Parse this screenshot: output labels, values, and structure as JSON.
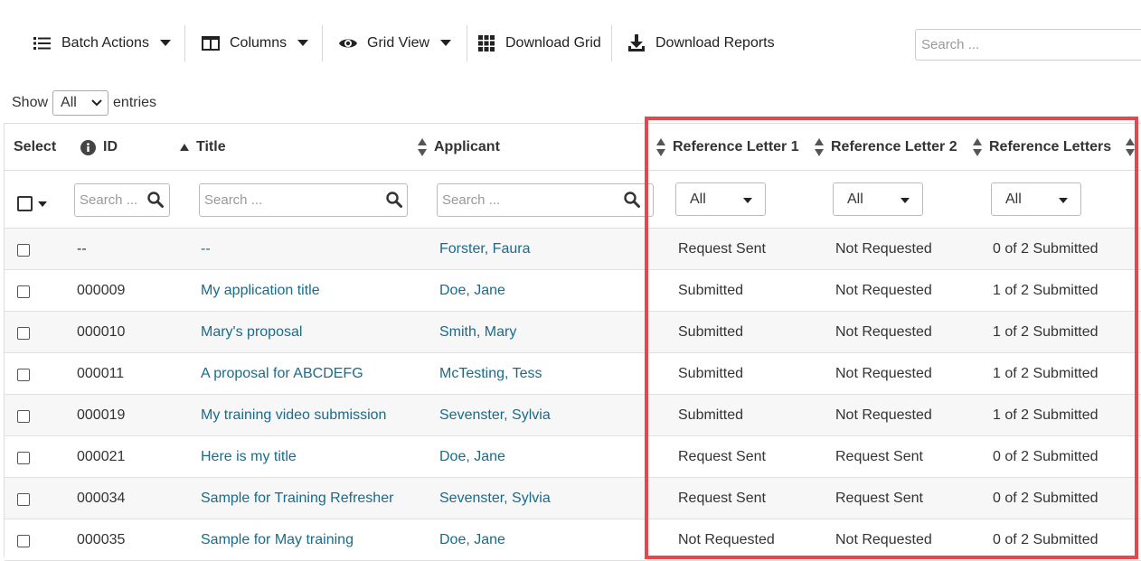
{
  "toolbar": {
    "batch_actions": "Batch Actions",
    "columns": "Columns",
    "grid_view": "Grid View",
    "download_grid": "Download Grid",
    "download_reports": "Download Reports",
    "search_placeholder": "Search ..."
  },
  "show_entries": {
    "prefix": "Show",
    "value": "All",
    "suffix": "entries"
  },
  "columns": {
    "select": "Select",
    "id": "ID",
    "title": "Title",
    "applicant": "Applicant",
    "ref1": "Reference Letter 1",
    "ref2": "Reference Letter 2",
    "refs": "Reference Letters"
  },
  "filters": {
    "id_placeholder": "Search ...",
    "title_placeholder": "Search ...",
    "applicant_placeholder": "Search ...",
    "ref1": "All",
    "ref2": "All",
    "refs": "All"
  },
  "rows": [
    {
      "id": "--",
      "title": "--",
      "applicant": "Forster, Faura",
      "ref1": "Request Sent",
      "ref2": "Not Requested",
      "refs": "0 of 2 Submitted"
    },
    {
      "id": "000009",
      "title": "My application title",
      "applicant": "Doe, Jane",
      "ref1": "Submitted",
      "ref2": "Not Requested",
      "refs": "1 of 2 Submitted"
    },
    {
      "id": "000010",
      "title": "Mary's proposal",
      "applicant": "Smith, Mary",
      "ref1": "Submitted",
      "ref2": "Not Requested",
      "refs": "1 of 2 Submitted"
    },
    {
      "id": "000011",
      "title": "A proposal for ABCDEFG",
      "applicant": "McTesting, Tess",
      "ref1": "Submitted",
      "ref2": "Not Requested",
      "refs": "1 of 2 Submitted"
    },
    {
      "id": "000019",
      "title": "My training video submission",
      "applicant": "Sevenster, Sylvia",
      "ref1": "Submitted",
      "ref2": "Not Requested",
      "refs": "1 of 2 Submitted"
    },
    {
      "id": "000021",
      "title": "Here is my title",
      "applicant": "Doe, Jane",
      "ref1": "Request Sent",
      "ref2": "Request Sent",
      "refs": "0 of 2 Submitted"
    },
    {
      "id": "000034",
      "title": "Sample for Training Refresher",
      "applicant": "Sevenster, Sylvia",
      "ref1": "Request Sent",
      "ref2": "Request Sent",
      "refs": "0 of 2 Submitted"
    },
    {
      "id": "000035",
      "title": "Sample for May training",
      "applicant": "Doe, Jane",
      "ref1": "Not Requested",
      "ref2": "Not Requested",
      "refs": "0 of 2 Submitted"
    }
  ],
  "colors": {
    "link": "#1a6b8a",
    "highlight": "#e5474d",
    "row_alt": "#f7f7f7"
  }
}
